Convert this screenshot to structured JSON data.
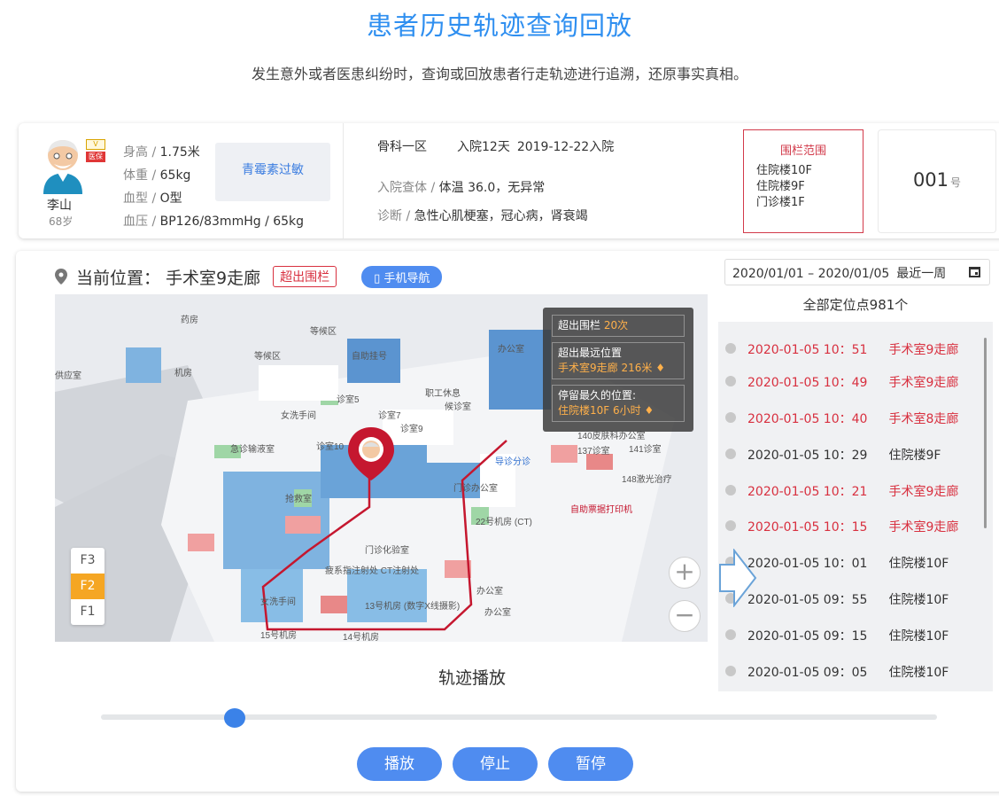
{
  "page": {
    "title": "患者历史轨迹查询回放",
    "subtitle": "发生意外或者医患纠纷时，查询或回放患者行走轨迹进行追溯，还原事实真相。"
  },
  "patient": {
    "name": "李山",
    "age": "68岁",
    "badge_vip": "V",
    "badge_pay": "医保",
    "height_label": "身高 /",
    "height_value": "1.75米",
    "weight_label": "体重 /",
    "weight_value": "65kg",
    "blood_label": "血型 /",
    "blood_value": "O型",
    "pressure_label": "血压 /",
    "pressure_value": "BP126/83mmHg / 65kg",
    "allergy": "青霉素过敏",
    "ward": "骨科一区",
    "admit_days": "入院12天",
    "admit_date": "2019-12-22入院",
    "exam_label": "入院查体 /",
    "exam_value": "体温 36.0，无异常",
    "diag_label": "诊断 /",
    "diag_value": "急性心肌梗塞，冠心病，肾衰竭",
    "fence_title": "围栏范围",
    "fence_items": [
      "住院楼10F",
      "住院楼9F",
      "门诊楼1F"
    ],
    "number": "001",
    "number_unit": "号"
  },
  "location": {
    "label": "当前位置：",
    "value": "手术室9走廊",
    "over_tag": "超出围栏",
    "nav_button": "手机导航"
  },
  "map": {
    "labels": {
      "pharmacy": "药房",
      "waiting": "等候区",
      "waiting2": "等候区",
      "computer": "机房",
      "supply": "供应室",
      "selfservice": "自助挂号",
      "registration": "挂号",
      "toilet": "女洗手间",
      "worker": "职工休息",
      "office": "办公室",
      "wait_room": "候诊室",
      "treat5": "诊室5",
      "treat7": "诊室7",
      "treat9": "诊室9",
      "treat10": "诊室10",
      "emergency": "急诊输液室",
      "rescue": "抢救室",
      "guide": "导诊分诊",
      "skin": "140皮肤科办公室",
      "room137": "137诊室",
      "room141": "141诊室",
      "laser": "148激光治疗",
      "printer": "自助票据打印机",
      "clinic_office": "门诊办公室",
      "ct22": "22号机房 (CT)",
      "lab": "门诊化验室",
      "inject": "疲系指注射处 CT注射处",
      "toilet2": "女洗手间",
      "room13": "13号机房 (数字X线摄影)",
      "office2": "办公室",
      "office3": "办公室",
      "room15": "15号机房",
      "room14": "14号机房"
    },
    "tooltip": {
      "over_label": "超出围栏",
      "over_count": "20次",
      "far_label": "超出最远位置",
      "far_place": "手术室9走廊",
      "far_dist": "216米",
      "stay_label": "停留最久的位置:",
      "stay_place": "住院楼10F",
      "stay_time": "6小时"
    },
    "floors": [
      "F3",
      "F2",
      "F1"
    ],
    "active_floor": "F2",
    "zoom_in": "+",
    "zoom_out": "−"
  },
  "date_range": {
    "range": "2020/01/01 – 2020/01/05",
    "recent": "最近一周"
  },
  "points": {
    "total": "全部定位点981个",
    "items": [
      {
        "time": "2020-01-05 10：51",
        "place": "手术室9走廊",
        "over": true
      },
      {
        "time": "2020-01-05 10：49",
        "place": "手术室9走廊",
        "over": true
      },
      {
        "time": "2020-01-05 10：40",
        "place": "手术室8走廊",
        "over": true
      },
      {
        "time": "2020-01-05 10：29",
        "place": "住院楼9F",
        "over": false
      },
      {
        "time": "2020-01-05 10：21",
        "place": "手术室9走廊",
        "over": true
      },
      {
        "time": "2020-01-05 10：15",
        "place": "手术室9走廊",
        "over": true
      },
      {
        "time": "2020-01-05 10：01",
        "place": "住院楼10F",
        "over": false
      },
      {
        "time": "2020-01-05 09：55",
        "place": "住院楼10F",
        "over": false
      },
      {
        "time": "2020-01-05 09：15",
        "place": "住院楼10F",
        "over": false
      },
      {
        "time": "2020-01-05 09：05",
        "place": "住院楼10F",
        "over": false
      }
    ]
  },
  "playback": {
    "title": "轨迹播放",
    "progress": 0.16,
    "play": "播放",
    "stop": "停止",
    "pause": "暂停"
  },
  "colors": {
    "accent": "#4f8cf0",
    "alert": "#d8303f",
    "title": "#2f8ff0"
  }
}
